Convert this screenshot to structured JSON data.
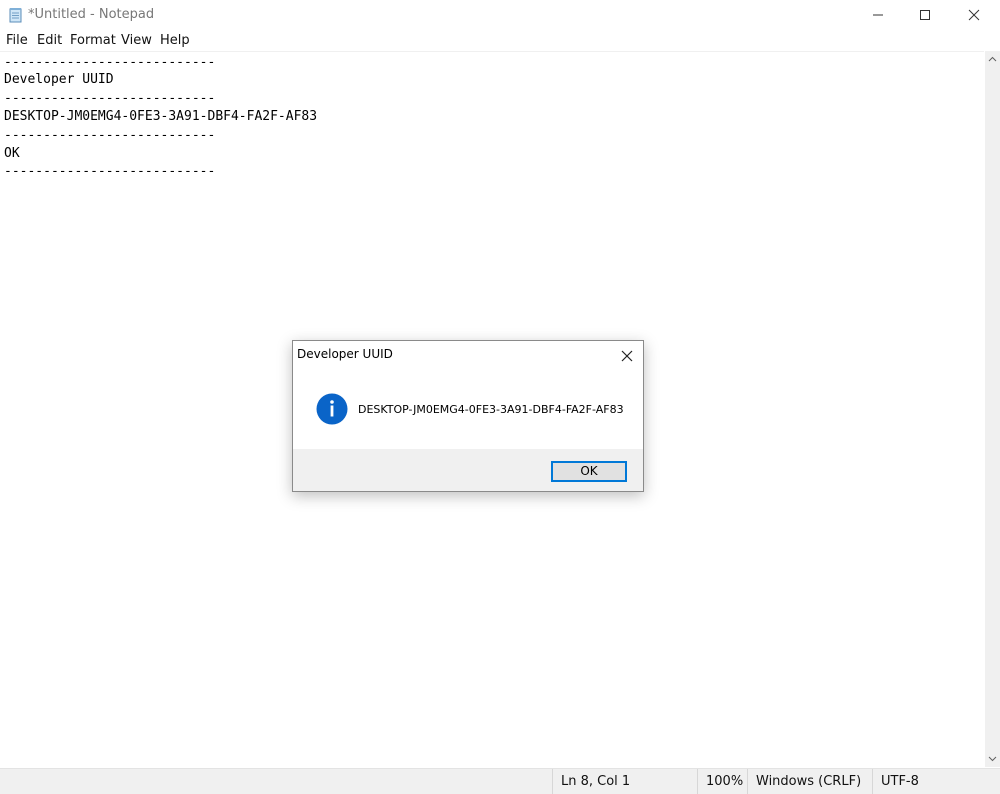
{
  "window": {
    "title": "*Untitled - Notepad",
    "controls": {
      "minimize": "minimize-icon",
      "maximize": "maximize-icon",
      "close": "close-icon"
    }
  },
  "menu": {
    "items": [
      "File",
      "Edit",
      "Format",
      "View",
      "Help"
    ]
  },
  "editor": {
    "lines": [
      "---------------------------",
      "Developer UUID",
      "---------------------------",
      "DESKTOP-JM0EMG4-0FE3-3A91-DBF4-FA2F-AF83",
      "---------------------------",
      "OK",
      "---------------------------"
    ]
  },
  "statusbar": {
    "position": "Ln 8, Col 1",
    "zoom": "100%",
    "line_ending": "Windows (CRLF)",
    "encoding": "UTF-8"
  },
  "dialog": {
    "title": "Developer UUID",
    "icon": "info-icon",
    "message": "DESKTOP-JM0EMG4-0FE3-3A91-DBF4-FA2F-AF83",
    "ok_label": "OK"
  },
  "colors": {
    "accent": "#0078d7",
    "info_icon": "#0a64c8"
  }
}
